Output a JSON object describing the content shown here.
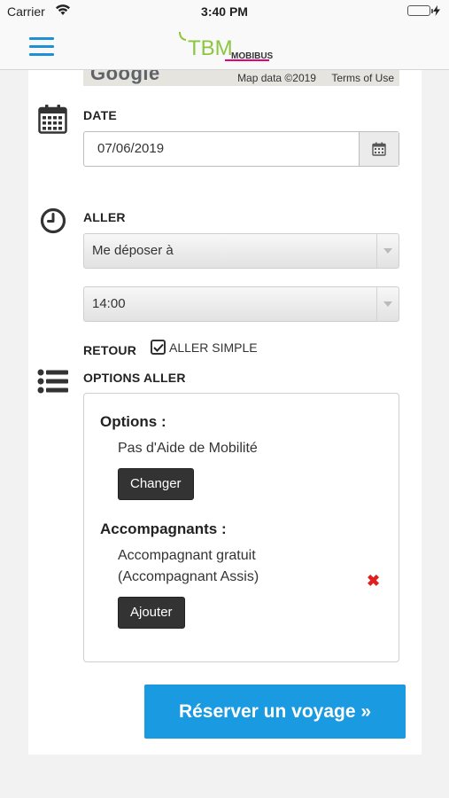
{
  "status_bar": {
    "carrier": "Carrier",
    "time": "3:40 PM"
  },
  "header": {
    "logo_main": "TBM",
    "logo_sub": "MOBIBUS",
    "brand_colors": {
      "accent": "#1e90d6",
      "logo_green": "#8cc63f",
      "logo_pink": "#e6007e"
    }
  },
  "map": {
    "provider": "Google",
    "map_data": "Map data ©2019",
    "terms": "Terms of Use"
  },
  "date_section": {
    "icon": "calendar-icon",
    "label": "DATE",
    "value": "07/06/2019"
  },
  "aller_section": {
    "icon": "clock-icon",
    "label": "ALLER",
    "mode_selected": "Me déposer à",
    "time_selected": "14:00"
  },
  "retour": {
    "label": "RETOUR",
    "checkbox_label": "ALLER SIMPLE",
    "checked": true
  },
  "options_section": {
    "icon": "list-icon",
    "label": "OPTIONS ALLER",
    "options_title": "Options :",
    "options_value": "Pas d'Aide de Mobilité",
    "change_label": "Changer",
    "companions_title": "Accompagnants :",
    "companion_line1": "Accompagnant gratuit",
    "companion_line2": "(Accompagnant Assis)",
    "add_label": "Ajouter"
  },
  "actions": {
    "reserve_label": "Réserver un voyage »",
    "reserve_color": "#1a9ae0"
  }
}
